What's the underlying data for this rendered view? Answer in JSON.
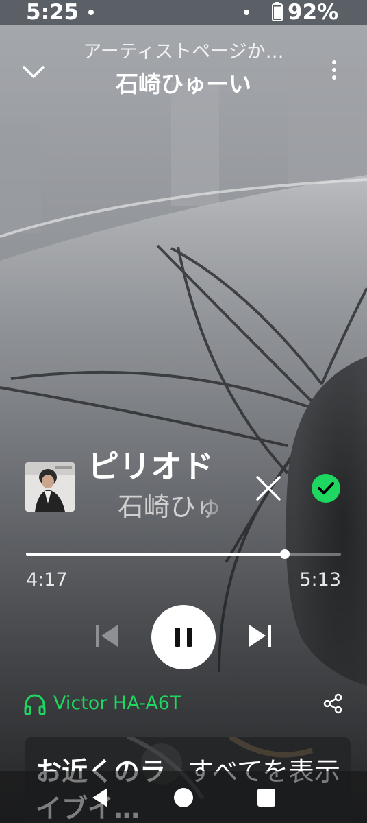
{
  "status_bar": {
    "time": "5:25",
    "battery_percent": "92%",
    "battery_level": 0.92
  },
  "header": {
    "context": "アーティストページか…",
    "artist": "石崎ひゅーい",
    "collapse_icon": "chevron-down-icon",
    "menu_icon": "more-vertical-icon"
  },
  "track": {
    "title": "ピリオド",
    "artist": "石崎ひゅ",
    "remove_icon": "close-icon",
    "saved_icon": "check-circle-icon",
    "saved_color": "#1ed760"
  },
  "progress": {
    "elapsed": "4:17",
    "total": "5:13",
    "fraction": 0.821
  },
  "controls": {
    "previous_icon": "skip-previous-icon",
    "pause_icon": "pause-icon",
    "next_icon": "skip-next-icon"
  },
  "device": {
    "name": "Victor HA-A6T",
    "icon": "headphones-icon",
    "color": "#1ed760",
    "share_icon": "share-icon"
  },
  "card": {
    "title": "お近くのライブイ…",
    "show_all": "すべてを表示"
  },
  "navbar": {
    "back_icon": "back-triangle-icon",
    "home_icon": "home-circle-icon",
    "recents_icon": "recents-square-icon"
  }
}
